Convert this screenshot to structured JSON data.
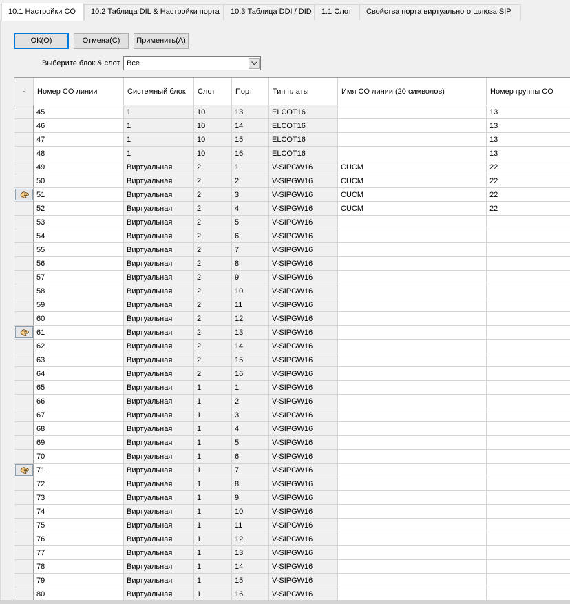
{
  "tabs": [
    {
      "label": "10.1 Настройки CO",
      "active": true
    },
    {
      "label": "10.2 Таблица DIL & Настройки порта",
      "active": false
    },
    {
      "label": "10.3 Таблица DDI / DID",
      "active": false
    },
    {
      "label": "1.1 Слот",
      "active": false
    },
    {
      "label": "Свойства порта виртуального шлюза SIP",
      "active": false
    }
  ],
  "toolbar": {
    "ok_label": "ОК(O)",
    "cancel_label": "Отмена(C)",
    "apply_label": "Применить(A)"
  },
  "filter": {
    "label": "Выберите блок & слот",
    "value": "Все"
  },
  "table": {
    "select_header": "-",
    "columns": [
      "Номер CO линии",
      "Системный блок",
      "Слот",
      "Порт",
      "Тип платы",
      "Имя CO линии (20 символов)",
      "Номер группы CO"
    ],
    "rows": [
      {
        "num": "45",
        "unit": "1",
        "slot": "10",
        "port": "13",
        "type": "ELCOT16",
        "name": "",
        "group": "13",
        "marker": false
      },
      {
        "num": "46",
        "unit": "1",
        "slot": "10",
        "port": "14",
        "type": "ELCOT16",
        "name": "",
        "group": "13",
        "marker": false
      },
      {
        "num": "47",
        "unit": "1",
        "slot": "10",
        "port": "15",
        "type": "ELCOT16",
        "name": "",
        "group": "13",
        "marker": false
      },
      {
        "num": "48",
        "unit": "1",
        "slot": "10",
        "port": "16",
        "type": "ELCOT16",
        "name": "",
        "group": "13",
        "marker": false
      },
      {
        "num": "49",
        "unit": "Виртуальная",
        "slot": "2",
        "port": "1",
        "type": "V-SIPGW16",
        "name": "CUCM",
        "group": "22",
        "marker": false
      },
      {
        "num": "50",
        "unit": "Виртуальная",
        "slot": "2",
        "port": "2",
        "type": "V-SIPGW16",
        "name": "CUCM",
        "group": "22",
        "marker": false
      },
      {
        "num": "51",
        "unit": "Виртуальная",
        "slot": "2",
        "port": "3",
        "type": "V-SIPGW16",
        "name": "CUCM",
        "group": "22",
        "marker": true
      },
      {
        "num": "52",
        "unit": "Виртуальная",
        "slot": "2",
        "port": "4",
        "type": "V-SIPGW16",
        "name": "CUCM",
        "group": "22",
        "marker": false
      },
      {
        "num": "53",
        "unit": "Виртуальная",
        "slot": "2",
        "port": "5",
        "type": "V-SIPGW16",
        "name": "",
        "group": "",
        "marker": false
      },
      {
        "num": "54",
        "unit": "Виртуальная",
        "slot": "2",
        "port": "6",
        "type": "V-SIPGW16",
        "name": "",
        "group": "",
        "marker": false
      },
      {
        "num": "55",
        "unit": "Виртуальная",
        "slot": "2",
        "port": "7",
        "type": "V-SIPGW16",
        "name": "",
        "group": "",
        "marker": false
      },
      {
        "num": "56",
        "unit": "Виртуальная",
        "slot": "2",
        "port": "8",
        "type": "V-SIPGW16",
        "name": "",
        "group": "",
        "marker": false
      },
      {
        "num": "57",
        "unit": "Виртуальная",
        "slot": "2",
        "port": "9",
        "type": "V-SIPGW16",
        "name": "",
        "group": "",
        "marker": false
      },
      {
        "num": "58",
        "unit": "Виртуальная",
        "slot": "2",
        "port": "10",
        "type": "V-SIPGW16",
        "name": "",
        "group": "",
        "marker": false
      },
      {
        "num": "59",
        "unit": "Виртуальная",
        "slot": "2",
        "port": "11",
        "type": "V-SIPGW16",
        "name": "",
        "group": "",
        "marker": false
      },
      {
        "num": "60",
        "unit": "Виртуальная",
        "slot": "2",
        "port": "12",
        "type": "V-SIPGW16",
        "name": "",
        "group": "",
        "marker": false
      },
      {
        "num": "61",
        "unit": "Виртуальная",
        "slot": "2",
        "port": "13",
        "type": "V-SIPGW16",
        "name": "",
        "group": "",
        "marker": true
      },
      {
        "num": "62",
        "unit": "Виртуальная",
        "slot": "2",
        "port": "14",
        "type": "V-SIPGW16",
        "name": "",
        "group": "",
        "marker": false
      },
      {
        "num": "63",
        "unit": "Виртуальная",
        "slot": "2",
        "port": "15",
        "type": "V-SIPGW16",
        "name": "",
        "group": "",
        "marker": false
      },
      {
        "num": "64",
        "unit": "Виртуальная",
        "slot": "2",
        "port": "16",
        "type": "V-SIPGW16",
        "name": "",
        "group": "",
        "marker": false
      },
      {
        "num": "65",
        "unit": "Виртуальная",
        "slot": "1",
        "port": "1",
        "type": "V-SIPGW16",
        "name": "",
        "group": "",
        "marker": false
      },
      {
        "num": "66",
        "unit": "Виртуальная",
        "slot": "1",
        "port": "2",
        "type": "V-SIPGW16",
        "name": "",
        "group": "",
        "marker": false
      },
      {
        "num": "67",
        "unit": "Виртуальная",
        "slot": "1",
        "port": "3",
        "type": "V-SIPGW16",
        "name": "",
        "group": "",
        "marker": false
      },
      {
        "num": "68",
        "unit": "Виртуальная",
        "slot": "1",
        "port": "4",
        "type": "V-SIPGW16",
        "name": "",
        "group": "",
        "marker": false
      },
      {
        "num": "69",
        "unit": "Виртуальная",
        "slot": "1",
        "port": "5",
        "type": "V-SIPGW16",
        "name": "",
        "group": "",
        "marker": false
      },
      {
        "num": "70",
        "unit": "Виртуальная",
        "slot": "1",
        "port": "6",
        "type": "V-SIPGW16",
        "name": "",
        "group": "",
        "marker": false
      },
      {
        "num": "71",
        "unit": "Виртуальная",
        "slot": "1",
        "port": "7",
        "type": "V-SIPGW16",
        "name": "",
        "group": "",
        "marker": true
      },
      {
        "num": "72",
        "unit": "Виртуальная",
        "slot": "1",
        "port": "8",
        "type": "V-SIPGW16",
        "name": "",
        "group": "",
        "marker": false
      },
      {
        "num": "73",
        "unit": "Виртуальная",
        "slot": "1",
        "port": "9",
        "type": "V-SIPGW16",
        "name": "",
        "group": "",
        "marker": false
      },
      {
        "num": "74",
        "unit": "Виртуальная",
        "slot": "1",
        "port": "10",
        "type": "V-SIPGW16",
        "name": "",
        "group": "",
        "marker": false
      },
      {
        "num": "75",
        "unit": "Виртуальная",
        "slot": "1",
        "port": "11",
        "type": "V-SIPGW16",
        "name": "",
        "group": "",
        "marker": false
      },
      {
        "num": "76",
        "unit": "Виртуальная",
        "slot": "1",
        "port": "12",
        "type": "V-SIPGW16",
        "name": "",
        "group": "",
        "marker": false
      },
      {
        "num": "77",
        "unit": "Виртуальная",
        "slot": "1",
        "port": "13",
        "type": "V-SIPGW16",
        "name": "",
        "group": "",
        "marker": false
      },
      {
        "num": "78",
        "unit": "Виртуальная",
        "slot": "1",
        "port": "14",
        "type": "V-SIPGW16",
        "name": "",
        "group": "",
        "marker": false
      },
      {
        "num": "79",
        "unit": "Виртуальная",
        "slot": "1",
        "port": "15",
        "type": "V-SIPGW16",
        "name": "",
        "group": "",
        "marker": false
      },
      {
        "num": "80",
        "unit": "Виртуальная",
        "slot": "1",
        "port": "16",
        "type": "V-SIPGW16",
        "name": "",
        "group": "",
        "marker": false
      }
    ]
  },
  "icons": {
    "row_marker": "hand-pointer-icon",
    "dropdown": "chevron-down-icon"
  },
  "colors": {
    "accent": "#0078d7",
    "readonly_cell": "#f0f0f0",
    "grid_line": "#d4d4d4"
  }
}
